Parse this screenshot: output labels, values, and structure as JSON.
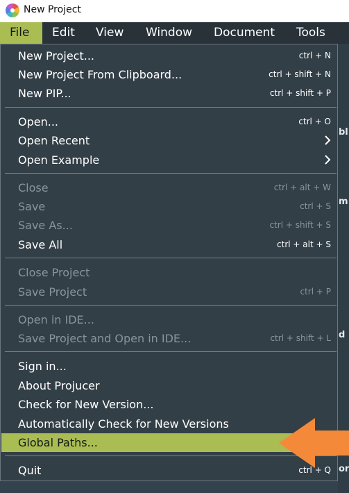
{
  "window": {
    "title": "New Project",
    "logo_icon": "projucer-logo-icon"
  },
  "menubar": {
    "items": [
      {
        "label": "File",
        "active": true
      },
      {
        "label": "Edit",
        "active": false
      },
      {
        "label": "View",
        "active": false
      },
      {
        "label": "Window",
        "active": false
      },
      {
        "label": "Document",
        "active": false
      },
      {
        "label": "Tools",
        "active": false
      }
    ]
  },
  "background_fragments": [
    "bl",
    "m",
    "d",
    "or"
  ],
  "file_menu": {
    "items": [
      {
        "label": "New Project...",
        "shortcut": "ctrl + N",
        "enabled": true
      },
      {
        "label": "New Project From Clipboard...",
        "shortcut": "ctrl + shift + N",
        "enabled": true
      },
      {
        "label": "New PIP...",
        "shortcut": "ctrl + shift + P",
        "enabled": true
      },
      {
        "label": "Open...",
        "shortcut": "ctrl + O",
        "enabled": true
      },
      {
        "label": "Open Recent",
        "submenu_icon": "chevron-right-icon",
        "enabled": true
      },
      {
        "label": "Open Example",
        "submenu_icon": "chevron-right-icon",
        "enabled": true
      },
      {
        "label": "Close",
        "shortcut": "ctrl + alt + W",
        "enabled": false
      },
      {
        "label": "Save",
        "shortcut": "ctrl + S",
        "enabled": false
      },
      {
        "label": "Save As...",
        "shortcut": "ctrl + shift + S",
        "enabled": false
      },
      {
        "label": "Save All",
        "shortcut": "ctrl + alt + S",
        "enabled": true
      },
      {
        "label": "Close Project",
        "enabled": false
      },
      {
        "label": "Save Project",
        "shortcut": "ctrl + P",
        "enabled": false
      },
      {
        "label": "Open in IDE...",
        "enabled": false
      },
      {
        "label": "Save Project and Open in IDE...",
        "shortcut": "ctrl + shift + L",
        "enabled": false
      },
      {
        "label": "Sign in...",
        "enabled": true
      },
      {
        "label": "About Projucer",
        "enabled": true
      },
      {
        "label": "Check for New Version...",
        "enabled": true
      },
      {
        "label": "Automatically Check for New Versions",
        "enabled": true
      },
      {
        "label": "Global Paths...",
        "enabled": true,
        "highlighted": true
      },
      {
        "label": "Quit",
        "shortcut": "ctrl + Q",
        "enabled": true
      }
    ]
  },
  "callout": {
    "icon": "orange-arrow-left-icon",
    "color": "#f5893a"
  },
  "colors": {
    "accent": "#a9bd53",
    "menu_bg": "#333f47",
    "menubar_bg": "#283238",
    "disabled_text": "#8a949b"
  }
}
